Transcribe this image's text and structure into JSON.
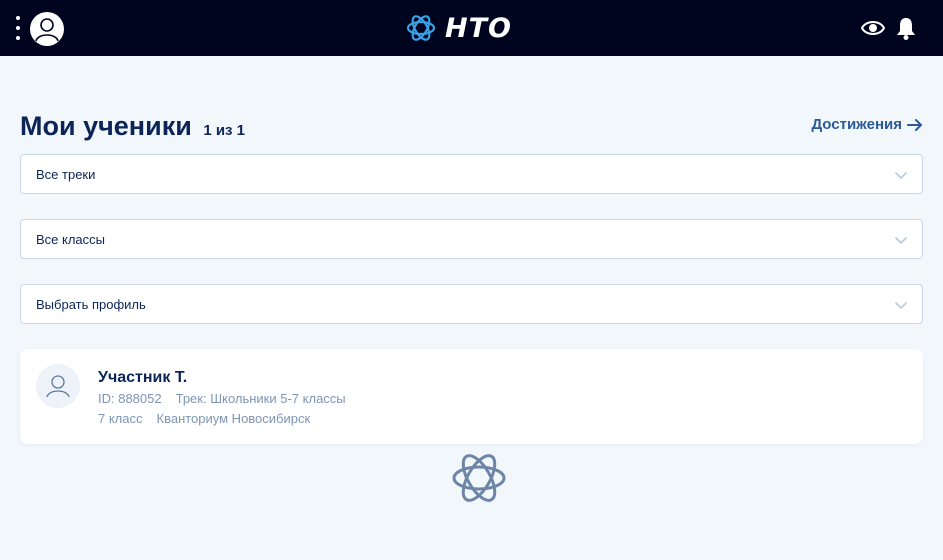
{
  "header": {
    "logo_text": "НТО",
    "icons": [
      "menu-dots-icon",
      "user-avatar-icon",
      "logo-mark-icon",
      "eye-icon",
      "bell-icon"
    ]
  },
  "page": {
    "title": "Мои ученики",
    "count": "1 из 1",
    "achievements_link": "Достижения"
  },
  "filters": {
    "tracks": "Все треки",
    "classes": "Все классы",
    "profile": "Выбрать профиль"
  },
  "students": [
    {
      "name": "Участник Т.",
      "id": "ID: 888052",
      "track": "Трек: Школьники 5-7 классы",
      "grade": "7 класс",
      "org": "Кванториум Новосибирск"
    }
  ],
  "colors": {
    "header_bg": "#00051f",
    "page_bg": "#f2f7fc",
    "title": "#0c2557",
    "link": "#2b5a99",
    "muted": "#7e95b5",
    "logo_accent": "#3aa0e6"
  }
}
